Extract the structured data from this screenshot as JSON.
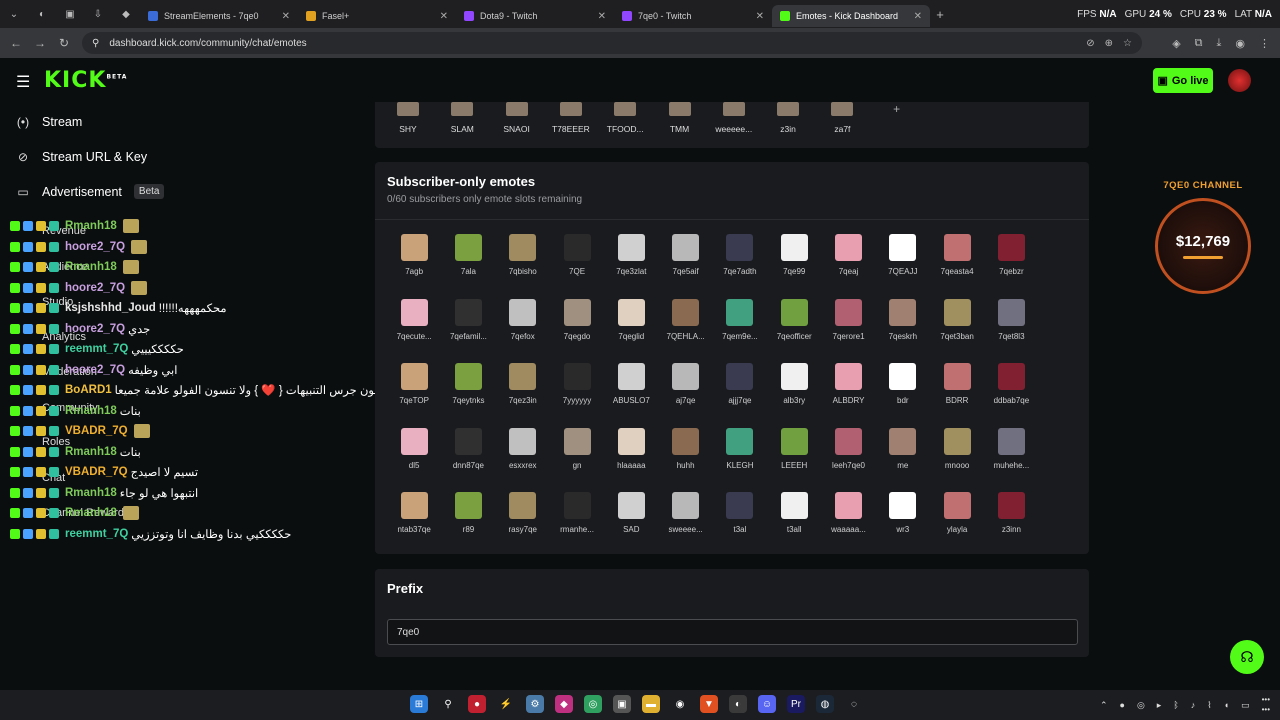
{
  "browser": {
    "tabs": [
      {
        "title": "StreamElements - 7qe0",
        "color": "#3a6bd6"
      },
      {
        "title": "Fasel+",
        "color": "#e0a020"
      },
      {
        "title": "Dota9 - Twitch",
        "color": "#9146ff"
      },
      {
        "title": "7qe0 - Twitch",
        "color": "#9146ff"
      },
      {
        "title": "Emotes - Kick Dashboard",
        "color": "#53fc18"
      }
    ],
    "url": "dashboard.kick.com/community/chat/emotes",
    "stats": {
      "fps_label": "FPS",
      "fps": "N/A",
      "gpu_label": "GPU",
      "gpu": "24 %",
      "cpu_label": "CPU",
      "cpu": "23 %",
      "lat_label": "LAT",
      "lat": "N/A"
    }
  },
  "header": {
    "logo": "KICK",
    "logo_beta": "BETA",
    "go_live": "Go live"
  },
  "sidebar": {
    "items": [
      {
        "label": "Stream",
        "icon": "(•)"
      },
      {
        "label": "Stream URL & Key",
        "icon": "⊘"
      },
      {
        "label": "Advertisement",
        "icon": "▭",
        "badge": "Beta"
      }
    ],
    "ghost_items": [
      "Revenue",
      "Audience",
      "Studio",
      "Analytics",
      "Moderation",
      "Community",
      "Roles",
      "Chat",
      "Channel Rewards"
    ]
  },
  "chat": [
    {
      "user": "Rmanh18",
      "color": "#7ecb5a",
      "msg": ""
    },
    {
      "user": "hoore2_7Q",
      "color": "#c8a0e0",
      "msg": ""
    },
    {
      "user": "Rmanh18",
      "color": "#7ecb5a",
      "msg": ""
    },
    {
      "user": "hoore2_7Q",
      "color": "#c8a0e0",
      "msg": ""
    },
    {
      "user": "ksjshshhd_Joud",
      "color": "#e8e8e8",
      "msg": "!!!!!!محكمهههه"
    },
    {
      "user": "hoore2_7Q",
      "color": "#c8a0e0",
      "msg": "جدي"
    },
    {
      "user": "reemmt_7Q",
      "color": "#3fd0a0",
      "msg": "حككككيييي"
    },
    {
      "user": "hoore2_7Q",
      "color": "#c8a0e0",
      "msg": "ابي وظيفه"
    },
    {
      "user": "BoARD1",
      "color": "#f0c040",
      "msg": "ولا تنسون تفعلون جرس التنبيهات { ❤️ } ولا تنسون الفولو علامة جميعا"
    },
    {
      "user": "Rmanh18",
      "color": "#7ecb5a",
      "msg": "بنات"
    },
    {
      "user": "VBADR_7Q",
      "color": "#f0b030",
      "msg": ""
    },
    {
      "user": "Rmanh18",
      "color": "#7ecb5a",
      "msg": "بنات"
    },
    {
      "user": "VBADR_7Q",
      "color": "#f0b030",
      "msg": "تسيم لا اصيدج"
    },
    {
      "user": "Rmanh18",
      "color": "#7ecb5a",
      "msg": "انتبهوا هي لو جاء"
    },
    {
      "user": "Rmanh18",
      "color": "#7ecb5a",
      "msg": ""
    },
    {
      "user": "reemmt_7Q",
      "color": "#3fd0a0",
      "msg": "حككككيي بدنا وظايف انا وتوتززيي"
    }
  ],
  "top_emotes": [
    "SHY",
    "SLAM",
    "SNAOI",
    "T78EEER",
    "TFOOD...",
    "TMM",
    "weeeee...",
    "z3in",
    "za7f"
  ],
  "subscriber": {
    "title": "Subscriber-only emotes",
    "subtitle": "0/60 subscribers only emote slots remaining",
    "emotes": [
      [
        "7agb",
        "7ala",
        "7qbisho",
        "7QE",
        "7qe3zlat",
        "7qe5aif",
        "7qe7adth",
        "7qe99",
        "7qeaj",
        "7QEAJJ",
        "7qeasta4",
        "7qebzr"
      ],
      [
        "7qecute...",
        "7qefamil...",
        "7qefox",
        "7qegdo",
        "7qeglid",
        "7QEHLA...",
        "7qem9e...",
        "7qeofficer",
        "7qerore1",
        "7qeskrh",
        "7qet3ban",
        "7qet8l3"
      ],
      [
        "7qeTOP",
        "7qeytnks",
        "7qez3in",
        "7yyyyyy",
        "ABUSLO7",
        "aj7qe",
        "ajjj7qe",
        "alb3ry",
        "ALBDRY",
        "bdr",
        "BDRR",
        "ddbab7qe"
      ],
      [
        "dl5",
        "dnn87qe",
        "esxxrex",
        "gn",
        "hlaaaaa",
        "huhh",
        "KLEGH",
        "LEEEH",
        "leeh7qe0",
        "me",
        "mnooo",
        "muhehe..."
      ],
      [
        "ntab37qe",
        "r89",
        "rasy7qe",
        "rmanhe...",
        "SAD",
        "sweeee...",
        "t3al",
        "t3all",
        "waaaaa...",
        "wr3",
        "ylayla",
        "z3inn"
      ]
    ]
  },
  "prefix": {
    "title": "Prefix",
    "value": "7qe0"
  },
  "widget": {
    "title": "7QE0 CHANNEL",
    "amount": "$12,769"
  }
}
